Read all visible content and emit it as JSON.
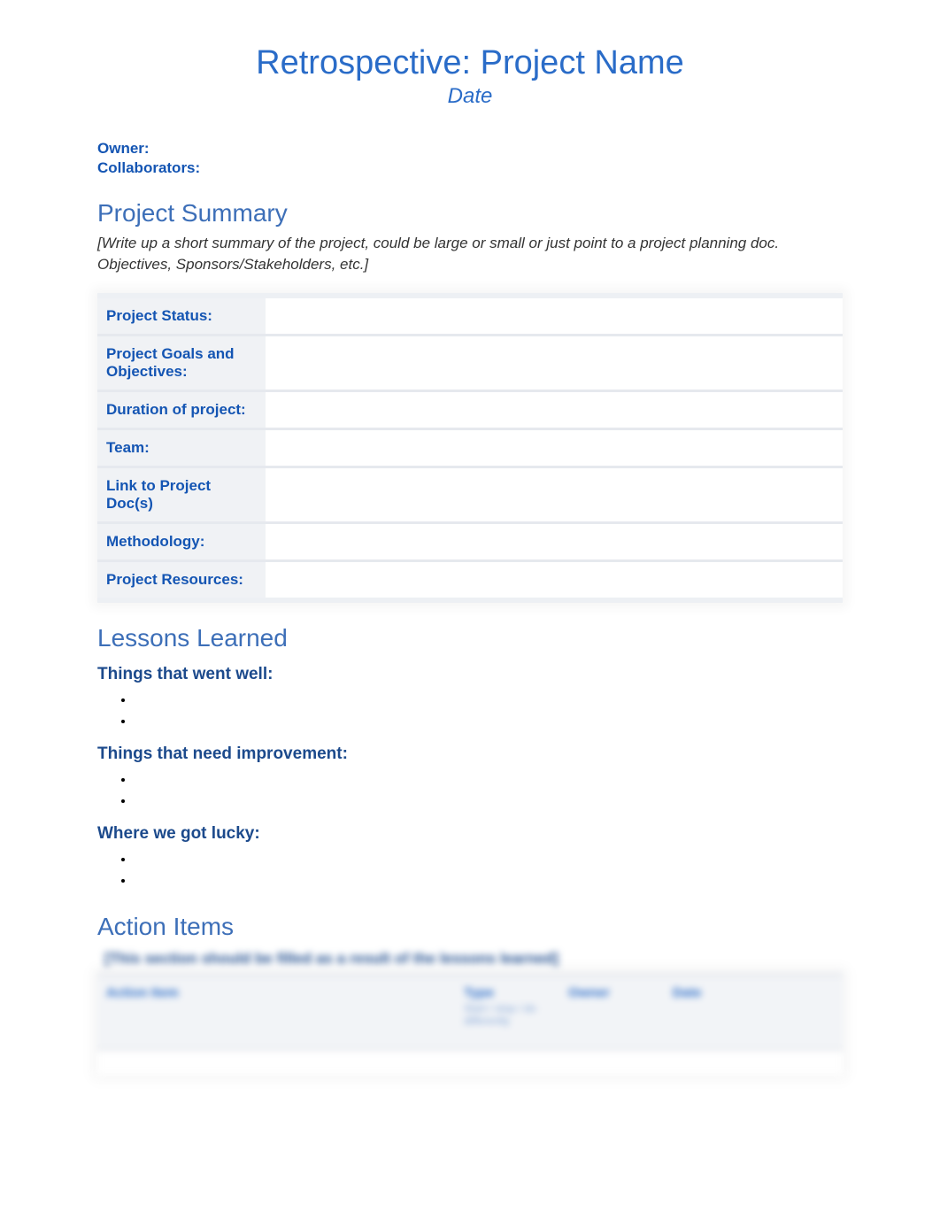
{
  "title": "Retrospective: Project Name",
  "subtitle": "Date",
  "meta": {
    "owner_label": "Owner:",
    "collaborators_label": "Collaborators:"
  },
  "sections": {
    "summary": {
      "heading": "Project Summary",
      "instructions": "[Write up a short summary of the project, could be large or small or just point to a project planning doc. Objectives, Sponsors/Stakeholders, etc.]",
      "rows": [
        {
          "label": "Project Status:",
          "value": ""
        },
        {
          "label": "Project Goals and Objectives:",
          "value": ""
        },
        {
          "label": "Duration of project:",
          "value": ""
        },
        {
          "label": "Team:",
          "value": ""
        },
        {
          "label": "Link to Project Doc(s)",
          "value": ""
        },
        {
          "label": "Methodology:",
          "value": ""
        },
        {
          "label": "Project Resources:",
          "value": ""
        }
      ]
    },
    "lessons": {
      "heading": "Lessons Learned",
      "went_well_label": "Things that went well:",
      "improve_label": "Things that need improvement:",
      "lucky_label": "Where we got lucky:",
      "went_well_items": [
        "",
        ""
      ],
      "improve_items": [
        "",
        ""
      ],
      "lucky_items": [
        "",
        ""
      ]
    },
    "actions": {
      "heading": "Action Items",
      "note": "[This section should be filled as a result of the lessons learned]",
      "columns": {
        "c1": "Action Item",
        "c2": "Type",
        "c2_sub": "Start / stop / do differently",
        "c3": "Owner",
        "c4": "Date"
      }
    }
  }
}
